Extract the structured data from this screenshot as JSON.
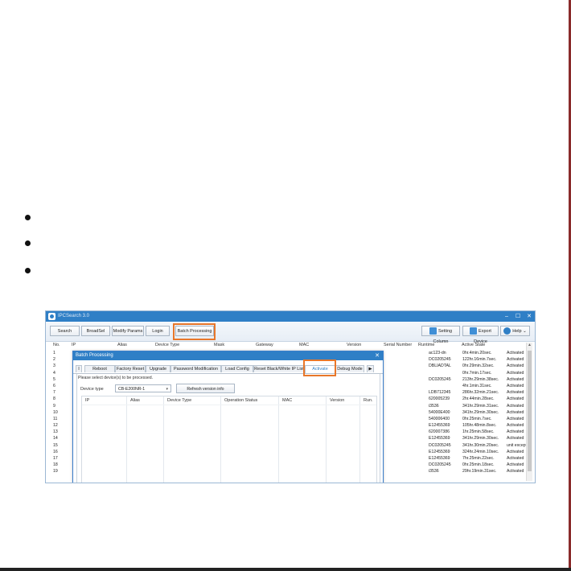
{
  "app": {
    "title": "IPCSearch 3.0",
    "window_controls": [
      "–",
      "☐",
      "✕"
    ],
    "toolbar": {
      "search": "Search",
      "broadsel": "BroadSel",
      "modify": "Modify Params",
      "login": "Login",
      "batch": "Batch Processing",
      "setting_column": "Setting Column",
      "export_device": "Export Device",
      "help": "Help"
    },
    "columns": [
      "No.",
      "IP",
      "Alias",
      "Device Type",
      "Mask",
      "Gateway",
      "MAC",
      "Version",
      "Serial Number",
      "Runtime",
      "Active State"
    ],
    "row_numbers": [
      "1",
      "2",
      "3",
      "4",
      "5",
      "6",
      "7",
      "8",
      "9",
      "10",
      "11",
      "12",
      "13",
      "14",
      "15",
      "16",
      "17",
      "18",
      "19"
    ],
    "rows": [
      {
        "serial": "ac123-dn",
        "runtime": "0hr.4min.20sec.",
        "state": "Activated"
      },
      {
        "serial": "DC0205245",
        "runtime": "122hr.16min.7sec.",
        "state": "Activated"
      },
      {
        "serial": "DBLIADTAL",
        "runtime": "0hr.29min.32sec.",
        "state": "Activated"
      },
      {
        "serial": "",
        "runtime": "0hr.7min.17sec.",
        "state": "Activated"
      },
      {
        "serial": "DC0205245",
        "runtime": "213hr.29min.38sec.",
        "state": "Activated"
      },
      {
        "serial": "",
        "runtime": "4hr.1min.31sec.",
        "state": "Activated"
      },
      {
        "serial": "LDB712345",
        "runtime": "286hr.32min.21sec.",
        "state": "Activated"
      },
      {
        "serial": "620005239",
        "runtime": "2hr.44min.28sec.",
        "state": "Activated"
      },
      {
        "serial": "i3536",
        "runtime": "341hr.29min.31sec.",
        "state": "Activated"
      },
      {
        "serial": "54000E400",
        "runtime": "341hr.29min.30sec.",
        "state": "Activated"
      },
      {
        "serial": "540006400",
        "runtime": "0hr.25min.7sec.",
        "state": "Activated"
      },
      {
        "serial": "E12455369",
        "runtime": "105hr.48min.8sec.",
        "state": "Activated"
      },
      {
        "serial": "620007386",
        "runtime": "1hr.25min.58sec.",
        "state": "Activated"
      },
      {
        "serial": "E12455369",
        "runtime": "341hr.29min.30sec.",
        "state": "Activated"
      },
      {
        "serial": "DC0205245",
        "runtime": "341hr.30min.20sec.",
        "state": "unit exception"
      },
      {
        "serial": "E12455369",
        "runtime": "324hr.24min.10sec.",
        "state": "Activated"
      },
      {
        "serial": "E12455369",
        "runtime": "7hr.25min.22sec.",
        "state": "Activated"
      },
      {
        "serial": "DC0205245",
        "runtime": "0hr.25min.18sec.",
        "state": "Activated"
      },
      {
        "serial": "i3536",
        "runtime": "29hr.19min.31sec.",
        "state": "Activated"
      }
    ]
  },
  "dialog": {
    "title": "Batch Processing",
    "close": "✕",
    "tabs": [
      "I",
      "Reboot",
      "Factory Reset",
      "Upgrade",
      "Password Modification",
      "Load Config",
      "Reset Black/White IP List",
      "Activate",
      "Debug Mode",
      "▶"
    ],
    "active_tab": "Activate",
    "hint": "Please select device(s) to be processed.",
    "device_type_label": "Device type",
    "device_type_value": "CB-E200NR-1",
    "refresh_label": "Refresh version info",
    "grid_columns": [
      "IP",
      "Alias",
      "Device Type",
      "Operation Status",
      "MAC",
      "Version",
      "Run."
    ]
  },
  "colors": {
    "titlebar": "#2f7fc6",
    "highlight": "#e8772a",
    "page_edge": "#8a2b2b"
  }
}
